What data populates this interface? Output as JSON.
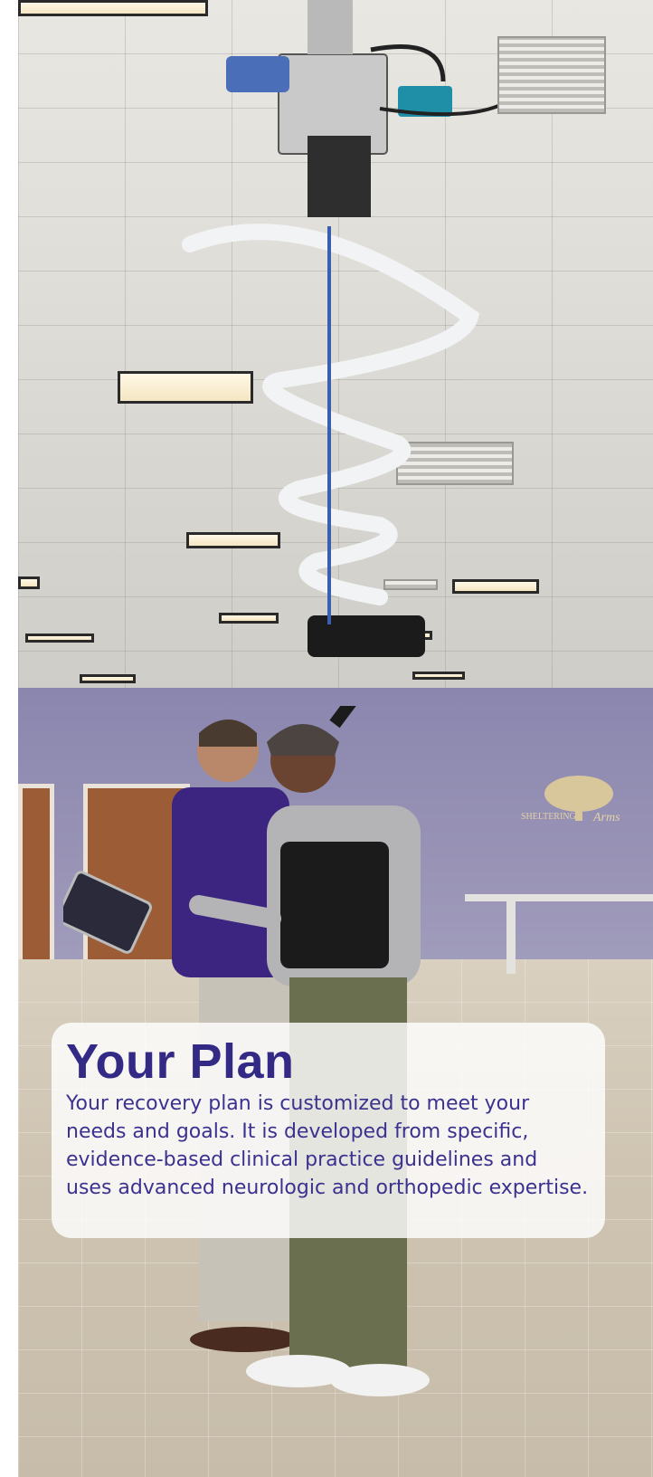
{
  "card": {
    "title": "Your Plan",
    "body": "Your recovery plan is customized to meet your needs and goals. It is developed from specific, evidence-based clinical practice guidelines and uses advanced neurologic and orthopedic expertise."
  },
  "photo": {
    "wall_sign_line1": "SHELTERING",
    "wall_sign_line2": "Arms"
  },
  "colors": {
    "title": "#332a86",
    "body": "#3b3290",
    "wall": "#8a86ae"
  }
}
